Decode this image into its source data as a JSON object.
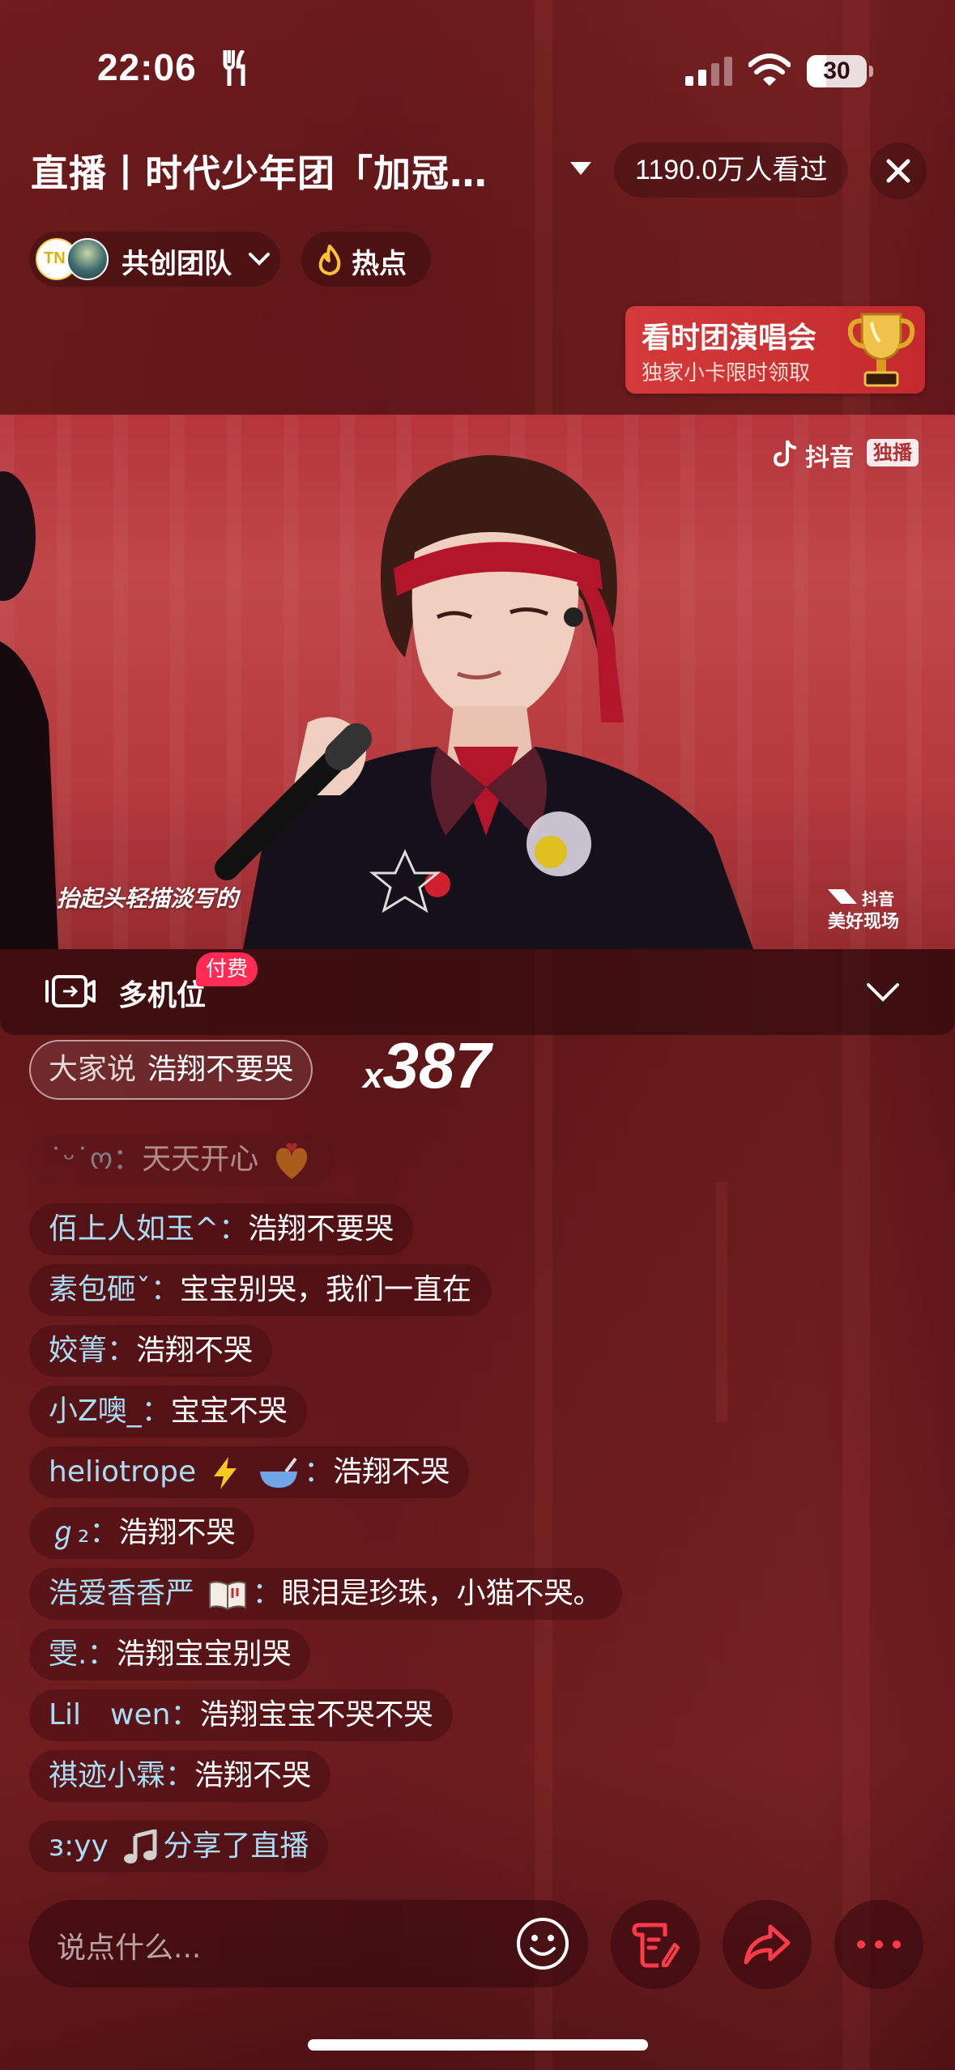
{
  "status_bar": {
    "time": "22:06",
    "battery": "30",
    "battery_level": 0.3
  },
  "header": {
    "title": "直播丨时代少年团「加冠…",
    "viewers": "1190.0万人看过",
    "team_label": "共创团队",
    "hot_label": "热点"
  },
  "promo": {
    "title": "看时团演唱会",
    "subtitle": "独家小卡限时领取"
  },
  "video": {
    "watermark_text": "抖音",
    "watermark_badge": "独播",
    "lyric": "抬起头轻描淡写的",
    "brand_line1": "抖音",
    "brand_line2": "美好现场"
  },
  "multicam": {
    "label": "多机位",
    "badge": "付费"
  },
  "hot_comment": {
    "prefix": "大家说",
    "text": "浩翔不要哭",
    "count_prefix": "x",
    "count": "387"
  },
  "chat": [
    {
      "user": "˙ᵕ˙ო：",
      "message": "天天开心"
    },
    {
      "user": "佰上人如玉^：",
      "message": "浩翔不要哭"
    },
    {
      "user": "素包砸ˇ：",
      "message": "宝宝别哭，我们一直在"
    },
    {
      "user": "姣箐：",
      "message": "浩翔不哭"
    },
    {
      "user": "小Z噢_：",
      "message": "宝宝不哭"
    },
    {
      "user": "heliotrope",
      "user_suffix": "：",
      "message": "浩翔不哭"
    },
    {
      "user": "ℊ₂：",
      "message": "浩翔不哭"
    },
    {
      "user": "浩爱香香严",
      "user_suffix": "：",
      "message": "眼泪是珍珠，小猫不哭。"
    },
    {
      "user": "雯.：",
      "message": "浩翔宝宝别哭"
    },
    {
      "user": "Lil　wen：",
      "message": "浩翔宝宝不哭不哭"
    },
    {
      "user": "祺迹小霖：",
      "message": "浩翔不哭"
    },
    {
      "user": "з:yy",
      "message": "分享了直播"
    }
  ],
  "input": {
    "placeholder": "说点什么..."
  },
  "icons": {
    "accent": "#fe2c55",
    "username_color": "#a9dcf5",
    "background": "#5c1518"
  }
}
